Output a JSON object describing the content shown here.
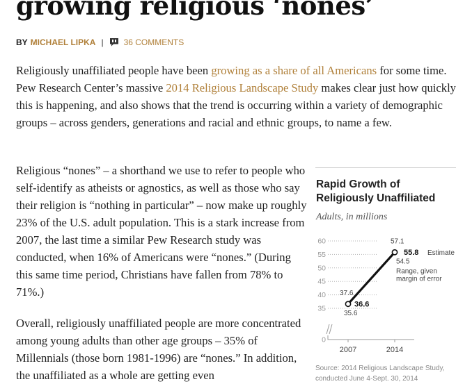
{
  "article": {
    "title_fragment": "growing religious ‘nones’",
    "byline": {
      "prefix": "BY",
      "author": "MICHAEL LIPKA",
      "separator": "|",
      "comments_label": "36 COMMENTS"
    },
    "p1": {
      "t1": "Religiously unaffiliated people have been ",
      "link1": "growing as a share of all Americans",
      "t2": " for some time. Pew Research Center’s massive ",
      "link2": "2014 Religious Landscape Study",
      "t3": " makes clear just how quickly this is happening, and also shows that the trend is occurring within a variety of demographic groups – across genders, generations and racial and ethnic groups, to name a few."
    },
    "p2": "Religious “nones” – a shorthand we use to refer to people who self-identify as atheists or agnostics, as well as those who say their religion is “nothing in particular” – now make up roughly 23% of the U.S. adult population. This is a stark increase from 2007, the last time a similar Pew Research study was conducted, when 16% of Americans were “nones.” (During this same time period, Christians have fallen from 78% to 71%.)",
    "p3": "Overall, religiously unaffiliated people are more concentrated among young adults than other age groups – 35% of Millennials (those born 1981-1996) are “nones.” In addition, the unaffiliated as a whole are getting even"
  },
  "chart": {
    "title": "Rapid Growth of Religiously Unaffiliated",
    "subtitle": "Adults, in millions",
    "source": "Source: 2014 Religious Landscape Study, conducted June 4-Sept. 30, 2014"
  },
  "chart_data": {
    "type": "line",
    "title": "Rapid Growth of Religiously Unaffiliated",
    "subtitle": "Adults, in millions",
    "x": [
      2007,
      2014
    ],
    "x_tick_labels": [
      "2007",
      "2014"
    ],
    "series": [
      {
        "name": "Estimate",
        "values": [
          36.6,
          55.8
        ],
        "range_low": [
          35.6,
          54.5
        ],
        "range_high": [
          37.6,
          57.1
        ]
      }
    ],
    "y_ticks": [
      0,
      35,
      40,
      45,
      50,
      55,
      60
    ],
    "y_tick_labels": [
      "0",
      "35",
      "40",
      "45",
      "50",
      "55",
      "60"
    ],
    "ylim": [
      35,
      60
    ],
    "y_axis_broken": true,
    "grid": "dotted-horizontal",
    "annotations": {
      "estimate_label": "Estimate",
      "range_label": [
        "Range, given",
        "margin of error"
      ]
    },
    "source": "Source: 2014 Religious Landscape Study, conducted June 4-Sept. 30, 2014",
    "colors": {
      "line": "#111111",
      "grid": "#b5b5b5",
      "axis_text": "#999999",
      "label_text": "#444444"
    }
  }
}
